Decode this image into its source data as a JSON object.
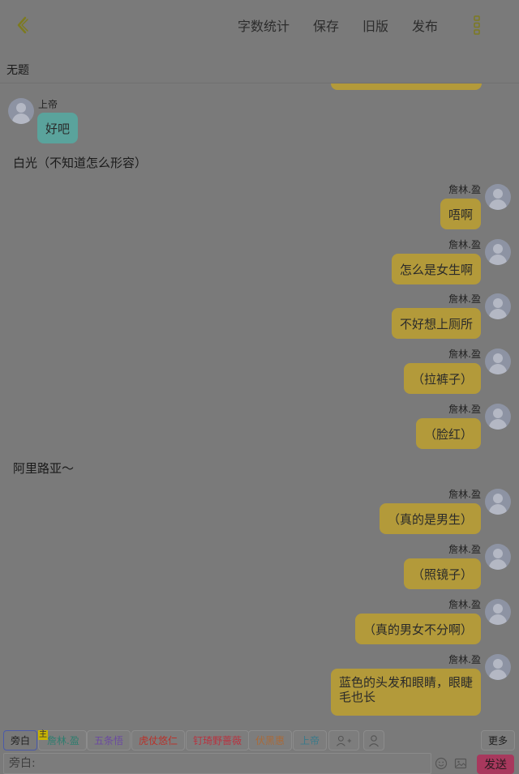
{
  "header": {
    "actions": [
      {
        "label": "字数统计"
      },
      {
        "label": "保存"
      },
      {
        "label": "旧版"
      },
      {
        "label": "发布"
      }
    ]
  },
  "document": {
    "title": "无题"
  },
  "messages": {
    "god_name": "上帝",
    "god_text": "好吧",
    "narration_1": "白光（不知道怎么形容）",
    "narration_2": "阿里路亚～",
    "speaker": "詹林.盈",
    "lines": [
      "唔啊",
      "怎么是女生啊",
      "不好想上厕所",
      "（拉裤子）",
      "（脸红）",
      "（真的是男生）",
      "（照镜子）",
      "（真的男女不分啊）",
      "蓝色的头发和眼睛，眼睫毛也长"
    ]
  },
  "bottom": {
    "chips": {
      "narration": "旁白",
      "host_tag": "主",
      "char1": "詹林.盈",
      "char2": "五条悟",
      "char3": "虎仗悠仁",
      "char4": "钉琦野蔷薇",
      "char5": "伏黑惠",
      "char6": "上帝",
      "more": "更多"
    },
    "input_placeholder": "旁白:",
    "send_label": "发送"
  },
  "colors": {
    "chip_char1": "#2e7d6e",
    "chip_char2": "#6b4aa0",
    "chip_char3": "#b8322b",
    "chip_char4": "#b8323f",
    "chip_char5": "#a86a3a",
    "chip_char6": "#3a7a8a"
  }
}
